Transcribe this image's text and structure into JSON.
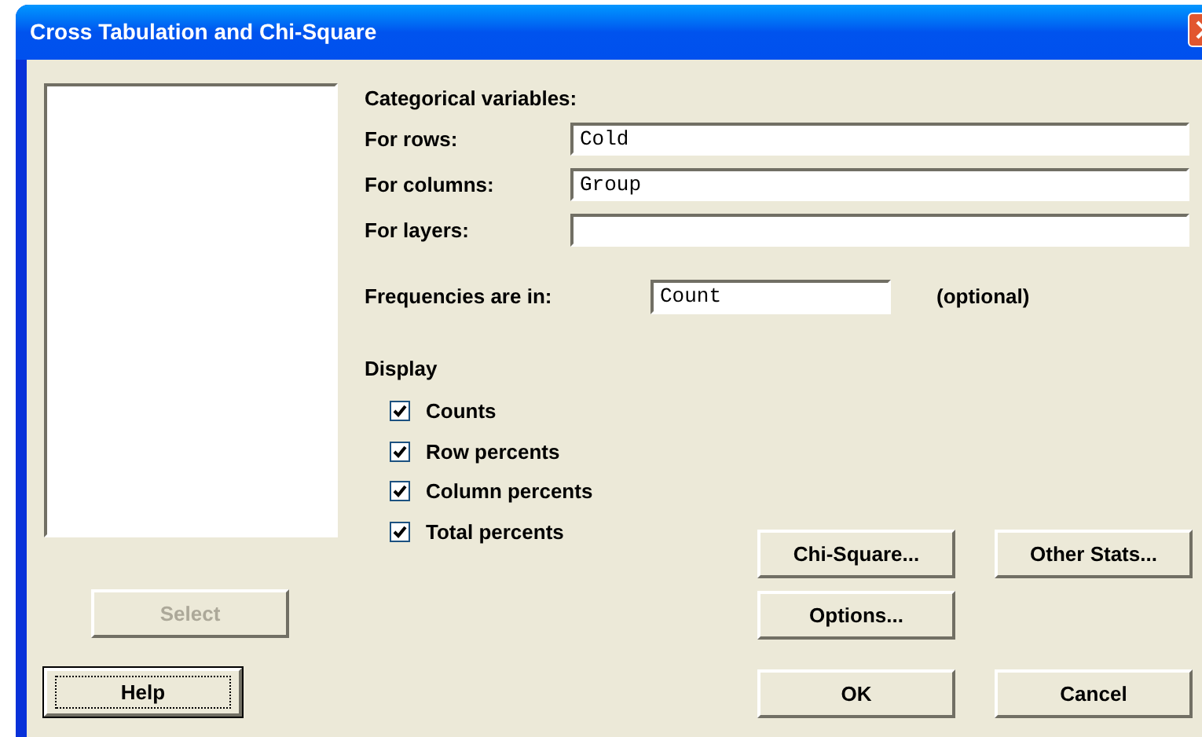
{
  "window": {
    "title": "Cross Tabulation and Chi-Square"
  },
  "select_button": {
    "label": "Select",
    "disabled": true
  },
  "help_button": {
    "label": "Help",
    "focused": true
  },
  "categorical_variables": {
    "heading": "Categorical variables:",
    "fields": [
      {
        "label": "For rows:",
        "value": "Cold"
      },
      {
        "label": "For columns:",
        "value": "Group"
      },
      {
        "label": "For layers:"
      }
    ]
  },
  "frequencies": {
    "label": "Frequencies are in:",
    "value": "Count",
    "note": "(optional)"
  },
  "display": {
    "heading": "Display",
    "options": [
      {
        "label": "Counts",
        "checked": true
      },
      {
        "label": "Row percents",
        "checked": true
      },
      {
        "label": "Column percents",
        "checked": true
      },
      {
        "label": "Total percents",
        "checked": true
      }
    ]
  },
  "button_rows": [
    [
      {
        "label": "Chi-Square..."
      },
      {
        "label": "Other Stats..."
      }
    ],
    [
      {
        "label": "Options..."
      }
    ],
    [
      {
        "label": "OK"
      },
      {
        "label": "Cancel"
      }
    ]
  ]
}
